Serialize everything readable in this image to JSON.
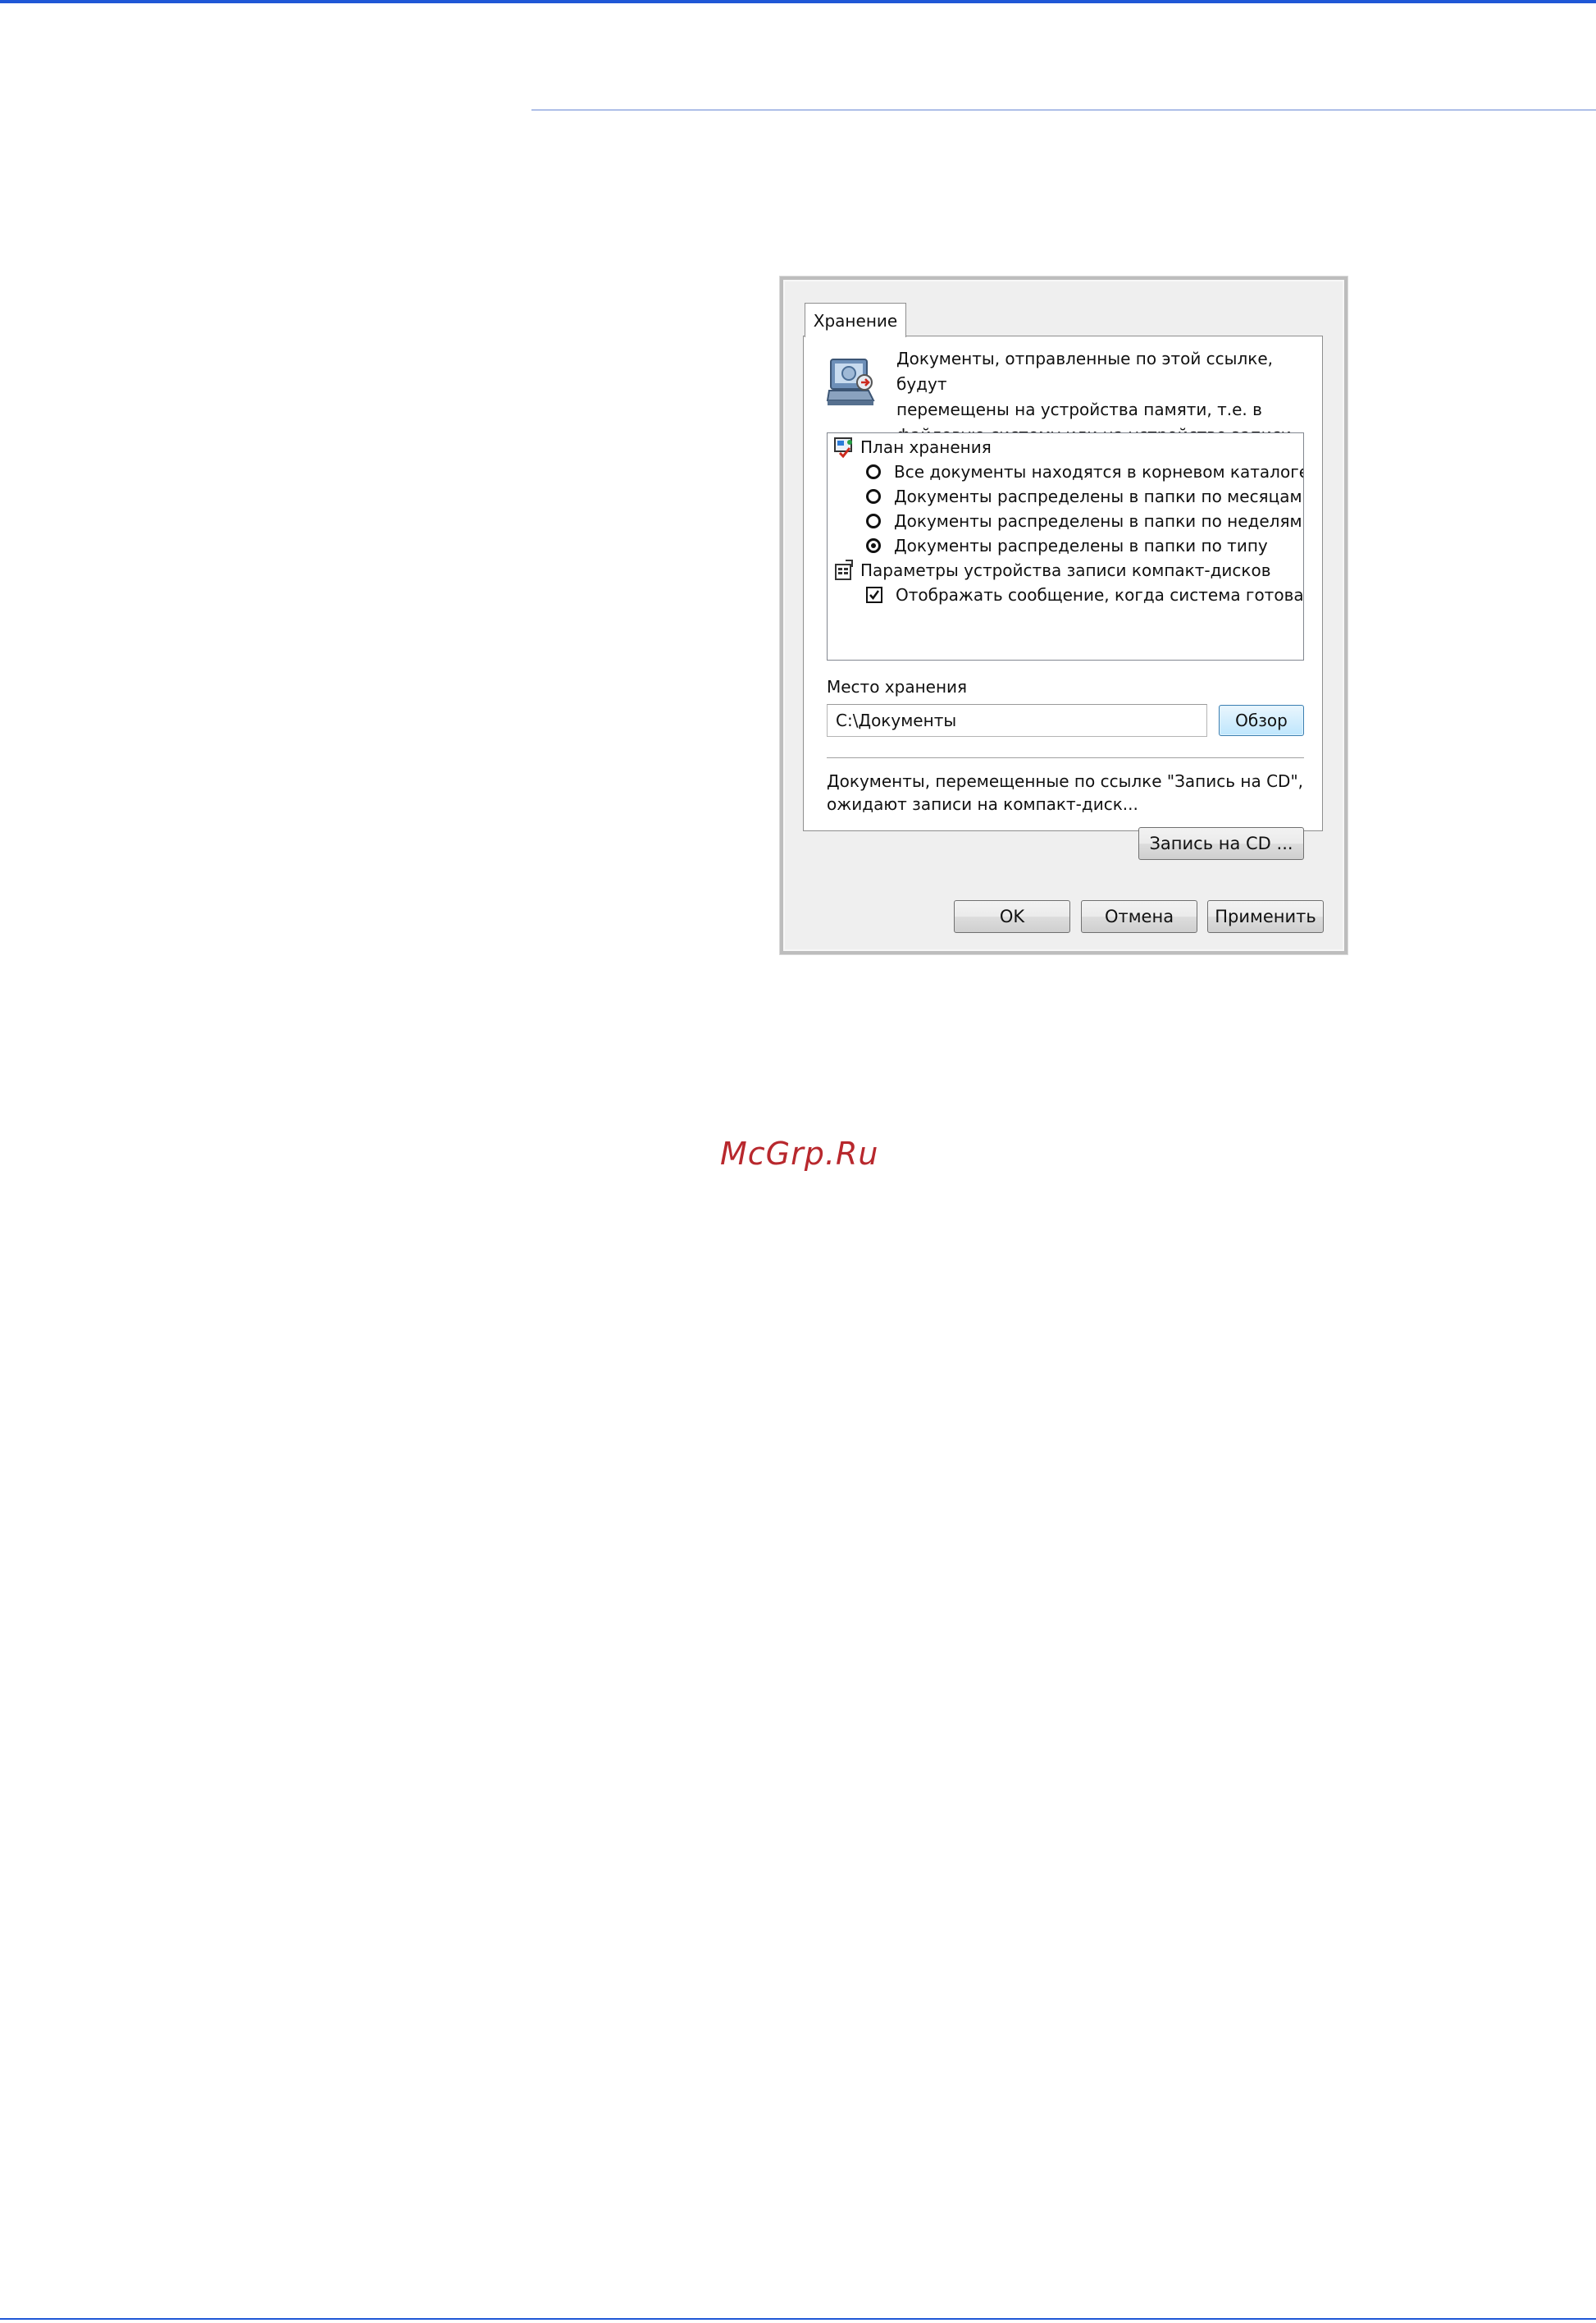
{
  "colors": {
    "accent_rule": "#1f57d6",
    "header_rule": "#aebfe8",
    "dialog_bg": "#efefef",
    "watermark": "#b8282d",
    "browse_button": "#bee6fd"
  },
  "dialog": {
    "tab_label": "Хранение",
    "intro_icon": "storage-device-icon",
    "intro_text": "Документы, отправленные по этой ссылке, будут\nперемещены на устройства памяти, т.е. в\nфайловую систему или на устройство записи\nкомпакт-дисков.",
    "tree": {
      "storage_plan": {
        "icon": "storage-plan-icon",
        "label": "План хранения",
        "options": [
          {
            "label": "Все документы находятся в корневом каталоге",
            "checked": false
          },
          {
            "label": "Документы распределены в папки по месяцам",
            "checked": false
          },
          {
            "label": "Документы распределены в папки по неделям",
            "checked": false
          },
          {
            "label": "Документы распределены в папки по типу",
            "checked": true
          }
        ]
      },
      "cd_settings": {
        "icon": "cd-settings-icon",
        "label": "Параметры устройства записи компакт-дисков",
        "checkbox_label": "Отображать сообщение, когда система готова к з",
        "checkbox_checked": true
      }
    },
    "location_label": "Место хранения",
    "location_value": "C:\\Документы",
    "browse_label": "Обзор",
    "cd_text": "Документы, перемещенные по ссылке \"Запись на CD\",\nожидают записи на компакт-диск...",
    "burn_label": "Запись на CD ...",
    "ok_label": "OK",
    "cancel_label": "Отмена",
    "apply_label": "Применить"
  },
  "watermark": "McGrp.Ru"
}
